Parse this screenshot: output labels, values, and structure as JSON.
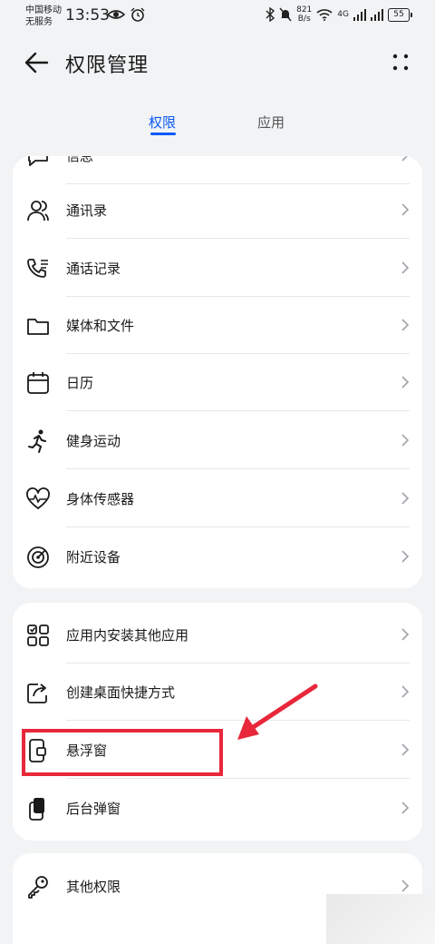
{
  "status_bar": {
    "carrier_line1": "中国移动",
    "carrier_line2": "无服务",
    "time": "13:53",
    "speed_value": "821",
    "speed_unit": "B/s",
    "network": "4G",
    "battery": "55"
  },
  "header": {
    "title": "权限管理"
  },
  "tabs": [
    {
      "label": "权限",
      "active": true
    },
    {
      "label": "应用",
      "active": false
    }
  ],
  "group1": [
    {
      "label": "信息",
      "icon": "message-icon"
    },
    {
      "label": "通讯录",
      "icon": "contacts-icon"
    },
    {
      "label": "通话记录",
      "icon": "call-log-icon"
    },
    {
      "label": "媒体和文件",
      "icon": "folder-icon"
    },
    {
      "label": "日历",
      "icon": "calendar-icon"
    },
    {
      "label": "健身运动",
      "icon": "running-icon"
    },
    {
      "label": "身体传感器",
      "icon": "heart-rate-icon"
    },
    {
      "label": "附近设备",
      "icon": "radar-icon"
    }
  ],
  "group2": [
    {
      "label": "应用内安装其他应用",
      "icon": "app-grid-icon"
    },
    {
      "label": "创建桌面快捷方式",
      "icon": "shortcut-icon"
    },
    {
      "label": "悬浮窗",
      "icon": "floating-window-icon"
    },
    {
      "label": "后台弹窗",
      "icon": "background-popup-icon"
    }
  ],
  "group3": [
    {
      "label": "其他权限",
      "icon": "key-icon"
    }
  ],
  "colors": {
    "accent": "#0a59f7",
    "highlight": "#e8273a"
  }
}
